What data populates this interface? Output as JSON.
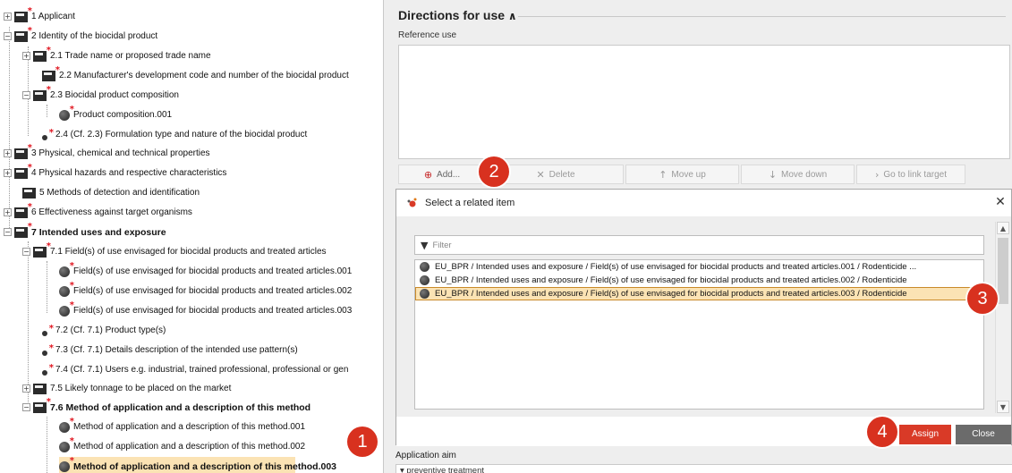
{
  "tree": {
    "items": [
      {
        "label": "1 Applicant",
        "exp": "+"
      },
      {
        "label": "2 Identity of the biocidal product",
        "exp": "−"
      },
      {
        "label": "2.1 Trade name or proposed trade name",
        "exp": "+"
      },
      {
        "label": "2.2 Manufacturer's development code and number of the biocidal product",
        "exp": ""
      },
      {
        "label": "2.3 Biocidal product composition",
        "exp": "−"
      },
      {
        "label": "Product composition.001",
        "exp": ""
      },
      {
        "label": "2.4 (Cf. 2.3) Formulation type and nature of the biocidal product",
        "exp": ""
      },
      {
        "label": "3 Physical, chemical and technical properties",
        "exp": "+"
      },
      {
        "label": "4 Physical hazards and respective characteristics",
        "exp": "+"
      },
      {
        "label": "5 Methods of detection and identification",
        "exp": ""
      },
      {
        "label": "6 Effectiveness against target organisms",
        "exp": "+"
      },
      {
        "label": "7 Intended uses and exposure",
        "exp": "−"
      },
      {
        "label": "7.1 Field(s) of use envisaged for biocidal products and treated articles",
        "exp": "−"
      },
      {
        "label": "Field(s) of use envisaged for biocidal products and treated articles.001",
        "exp": ""
      },
      {
        "label": "Field(s) of use envisaged for biocidal products and treated articles.002",
        "exp": ""
      },
      {
        "label": "Field(s) of use envisaged for biocidal products and treated articles.003",
        "exp": ""
      },
      {
        "label": "7.2 (Cf. 7.1) Product type(s)",
        "exp": ""
      },
      {
        "label": "7.3 (Cf. 7.1) Details description of the intended use pattern(s)",
        "exp": ""
      },
      {
        "label": "7.4 (Cf. 7.1) Users e.g. industrial, trained professional, professional or gen",
        "exp": ""
      },
      {
        "label": "7.5 Likely tonnage to be placed on the market",
        "exp": "+"
      },
      {
        "label": "7.6 Method of application and a description of this method",
        "exp": "−"
      },
      {
        "label": "Method of application and a description of this method.001",
        "exp": ""
      },
      {
        "label": "Method of application and a description of this method.002",
        "exp": ""
      },
      {
        "label": "Method of application and a description of this method.003",
        "exp": ""
      }
    ]
  },
  "panel": {
    "section_title": "Directions for use",
    "collapse_glyph": "∧",
    "reference_use_label": "Reference use",
    "buttons": {
      "add": "Add...",
      "delete": "Delete",
      "move_up": "Move up",
      "move_down": "Move down",
      "go_to_link": "Go to link target"
    },
    "application_aim_label": "Application aim",
    "application_aim_value": "▾ preventive treatment"
  },
  "dialog": {
    "title": "Select a related item",
    "filter_placeholder": "Filter",
    "results": [
      "EU_BPR / Intended uses and exposure / Field(s) of use envisaged for biocidal products and treated articles.001 / Rodenticide ...",
      "EU_BPR / Intended uses and exposure / Field(s) of use envisaged for biocidal products and treated articles.002 / Rodenticide",
      "EU_BPR / Intended uses and exposure / Field(s) of use envisaged for biocidal products and treated articles.003 / Rodenticide"
    ],
    "assign_label": "Assign",
    "close_label": "Close"
  },
  "callouts": [
    "1",
    "2",
    "3",
    "4"
  ],
  "colors": {
    "callout": "#d8311f",
    "selection": "#fbe3b4",
    "assign": "#d93a27",
    "required_star": "#e0141e"
  },
  "icons": {
    "section_folder": "folder-icon",
    "record": "record-ball-icon",
    "required": "required-star-icon"
  }
}
